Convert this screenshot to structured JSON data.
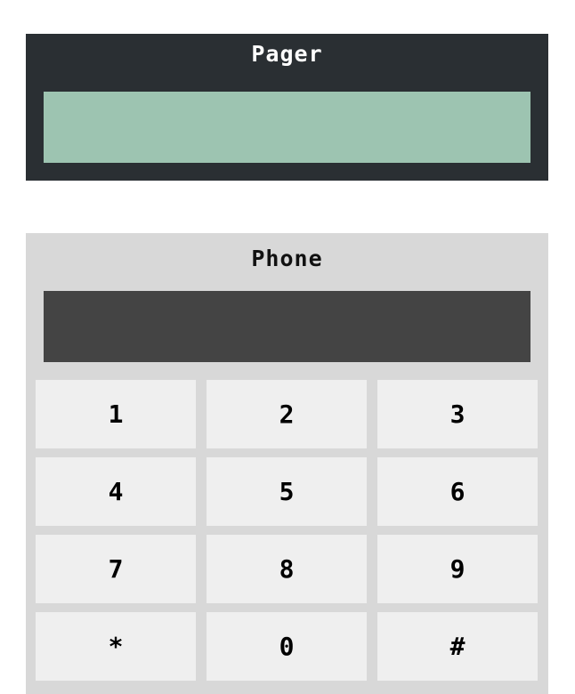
{
  "pager": {
    "title": "Pager",
    "screen_text": ""
  },
  "phone": {
    "title": "Phone",
    "display_text": "",
    "keys": [
      "1",
      "2",
      "3",
      "4",
      "5",
      "6",
      "7",
      "8",
      "9",
      "*",
      "0",
      "#"
    ]
  },
  "colors": {
    "pager_bg": "#2a2f33",
    "pager_screen": "#9dc4b1",
    "phone_bg": "#d8d8d8",
    "phone_display": "#444444",
    "key_bg": "#efefef"
  }
}
